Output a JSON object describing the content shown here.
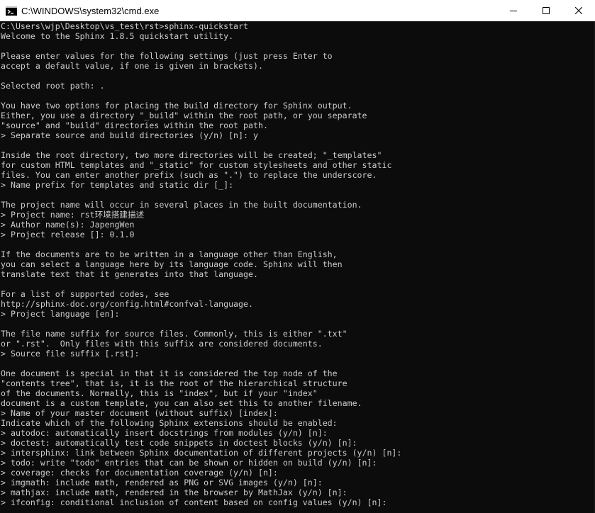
{
  "window": {
    "title": "C:\\WINDOWS\\system32\\cmd.exe",
    "icon": "cmd-icon",
    "controls": {
      "minimize": "minimize-icon",
      "maximize": "maximize-icon",
      "close": "close-icon"
    },
    "colors": {
      "titlebar_bg": "#ffffff",
      "console_bg": "#0c0c0c",
      "console_text": "#cccccc"
    }
  },
  "console": {
    "lines": [
      "C:\\Users\\wjp\\Desktop\\vs_test\\rst>sphinx-quickstart",
      "Welcome to the Sphinx 1.8.5 quickstart utility.",
      "",
      "Please enter values for the following settings (just press Enter to",
      "accept a default value, if one is given in brackets).",
      "",
      "Selected root path: .",
      "",
      "You have two options for placing the build directory for Sphinx output.",
      "Either, you use a directory \"_build\" within the root path, or you separate",
      "\"source\" and \"build\" directories within the root path.",
      "> Separate source and build directories (y/n) [n]: y",
      "",
      "Inside the root directory, two more directories will be created; \"_templates\"",
      "for custom HTML templates and \"_static\" for custom stylesheets and other static",
      "files. You can enter another prefix (such as \".\") to replace the underscore.",
      "> Name prefix for templates and static dir [_]:",
      "",
      "The project name will occur in several places in the built documentation.",
      "> Project name: rst环境搭建描述",
      "> Author name(s): JapengWen",
      "> Project release []: 0.1.0",
      "",
      "If the documents are to be written in a language other than English,",
      "you can select a language here by its language code. Sphinx will then",
      "translate text that it generates into that language.",
      "",
      "For a list of supported codes, see",
      "http://sphinx-doc.org/config.html#confval-language.",
      "> Project language [en]:",
      "",
      "The file name suffix for source files. Commonly, this is either \".txt\"",
      "or \".rst\".  Only files with this suffix are considered documents.",
      "> Source file suffix [.rst]:",
      "",
      "One document is special in that it is considered the top node of the",
      "\"contents tree\", that is, it is the root of the hierarchical structure",
      "of the documents. Normally, this is \"index\", but if your \"index\"",
      "document is a custom template, you can also set this to another filename.",
      "> Name of your master document (without suffix) [index]:",
      "Indicate which of the following Sphinx extensions should be enabled:",
      "> autodoc: automatically insert docstrings from modules (y/n) [n]:",
      "> doctest: automatically test code snippets in doctest blocks (y/n) [n]:",
      "> intersphinx: link between Sphinx documentation of different projects (y/n) [n]:",
      "> todo: write \"todo\" entries that can be shown or hidden on build (y/n) [n]:",
      "> coverage: checks for documentation coverage (y/n) [n]:",
      "> imgmath: include math, rendered as PNG or SVG images (y/n) [n]:",
      "> mathjax: include math, rendered in the browser by MathJax (y/n) [n]:",
      "> ifconfig: conditional inclusion of content based on config values (y/n) [n]:"
    ]
  }
}
